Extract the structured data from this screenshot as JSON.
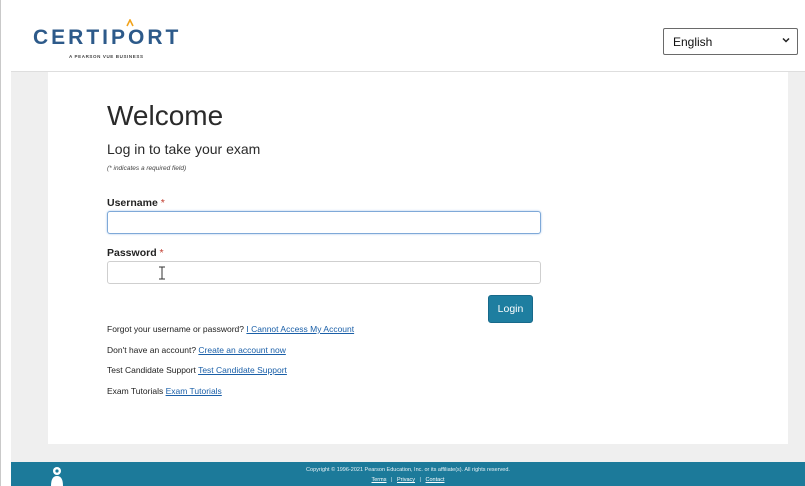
{
  "header": {
    "logo_text": "CERTIPORT",
    "logo_tagline": "A PEARSON VUE BUSINESS",
    "language_select": {
      "value": "English"
    }
  },
  "login": {
    "title": "Welcome",
    "subtitle": "Log in to take your exam",
    "required_note": "(* indicates a required field)",
    "username_label": "Username",
    "password_label": "Password",
    "required_mark": "*",
    "username_value": "",
    "password_value": "",
    "login_button": "Login"
  },
  "links": [
    {
      "text": "Forgot your username or password?",
      "link": "I Cannot Access My Account"
    },
    {
      "text": "Don't have an account?",
      "link": "Create an account now"
    },
    {
      "text": "Test Candidate Support",
      "link": "Test Candidate Support"
    },
    {
      "text": "Exam Tutorials",
      "link": "Exam Tutorials"
    }
  ],
  "footer": {
    "copyright": "Copyright © 1996-2021 Pearson Education, Inc. or its affiliate(s). All rights reserved.",
    "terms": "Terms",
    "privacy": "Privacy",
    "contact": "Contact",
    "separator": "|"
  },
  "colors": {
    "brand_blue": "#2d5a8a",
    "accent_orange": "#f2a31b",
    "button_teal": "#1e7ea0",
    "footer_teal": "#1c7a9a",
    "link_blue": "#1a5fa8"
  },
  "icons": {
    "lang_dropdown": "chevron-down-icon",
    "footer": "person-icon",
    "cursor": "text-cursor-icon"
  }
}
